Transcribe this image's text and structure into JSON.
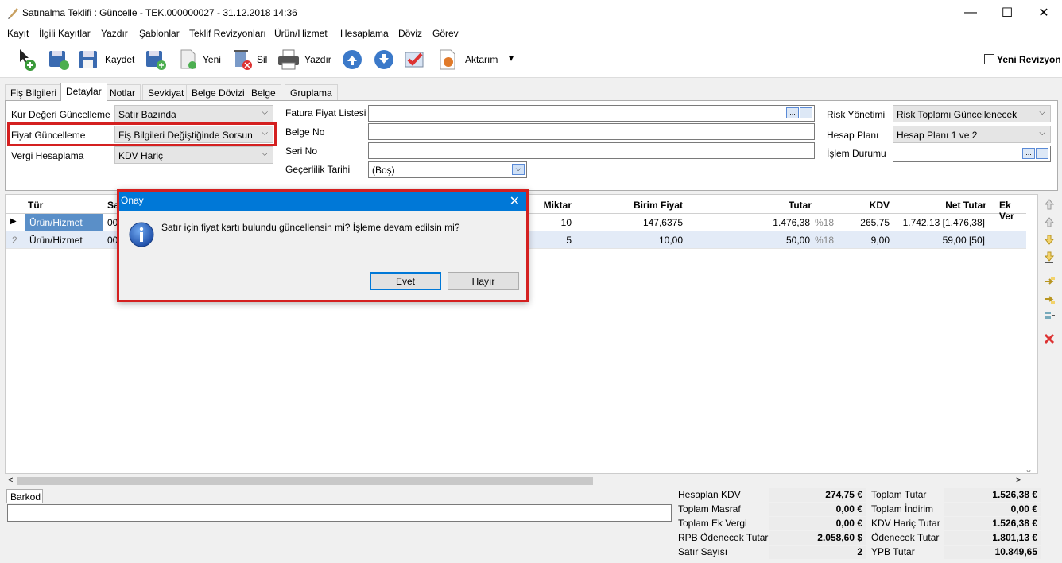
{
  "window": {
    "title": "Satınalma Teklifi : Güncelle - TEK.000000027 - 31.12.2018 14:36",
    "minimize": "—",
    "maximize": "☐",
    "close": "✕"
  },
  "menu": [
    "Kayıt",
    "İlgili Kayıtlar",
    "Yazdır",
    "Şablonlar",
    "Teklif Revizyonları",
    "Ürün/Hizmet",
    "Hesaplama",
    "Döviz",
    "Görev"
  ],
  "toolbar": {
    "save_label": "Kaydet",
    "new_label": "Yeni",
    "delete_label": "Sil",
    "print_label": "Yazdır",
    "export_label": "Aktarım",
    "export_arrow": "▾",
    "new_revision_label": "Yeni Revizyon"
  },
  "tabs": [
    "Fiş Bilgileri",
    "Detaylar",
    "Notlar",
    "Sevkiyat",
    "Belge Dövizi",
    "Belge",
    "Gruplama"
  ],
  "active_tab": "Detaylar",
  "details": {
    "kur_label": "Kur Değeri Güncelleme",
    "kur_value": "Satır Bazında",
    "fiyat_label": "Fiyat Güncelleme",
    "fiyat_value": "Fiş Bilgileri Değiştiğinde Sorsun",
    "vergi_label": "Vergi Hesaplama",
    "vergi_value": "KDV Hariç",
    "fatura_label": "Fatura Fiyat Listesi",
    "belge_no_label": "Belge No",
    "seri_no_label": "Seri No",
    "gecerlilik_label": "Geçerlilik Tarihi",
    "gecerlilik_value": "(Boş)",
    "risk_label": "Risk Yönetimi",
    "risk_value": "Risk Toplamı Güncellenecek",
    "hesap_label": "Hesap Planı",
    "hesap_value": "Hesap Planı 1 ve 2",
    "islem_label": "İşlem Durumu",
    "ellipsis": "...",
    "dropdown_arrow": "⌵"
  },
  "grid": {
    "headers": [
      "Tür",
      "Sa",
      "Miktar",
      "Birim Fiyat",
      "Tutar",
      "KDV",
      "Net Tutar",
      "Ek Ver"
    ],
    "rows": [
      {
        "indicator": "▶",
        "tur": "Ürün/Hizmet",
        "sa": "00",
        "miktar": "10",
        "birim": "147,6375",
        "tutar": "1.476,38",
        "kdvrate": "%18",
        "kdv": "265,75",
        "net": "1.742,13 [1.476,38]"
      },
      {
        "indicator": "2",
        "tur": "Ürün/Hizmet",
        "sa": "00",
        "miktar": "5",
        "birim": "10,00",
        "tutar": "50,00",
        "kdvrate": "%18",
        "kdv": "9,00",
        "net": "59,00 [50]"
      }
    ]
  },
  "barcode_tab": "Barkod",
  "totals": {
    "left": [
      {
        "label": "Hesaplan KDV",
        "value": "274,75 €"
      },
      {
        "label": "Toplam Masraf",
        "value": "0,00 €"
      },
      {
        "label": "Toplam Ek Vergi",
        "value": "0,00 €"
      },
      {
        "label": "RPB Ödenecek Tutar",
        "value": "2.058,60 $"
      },
      {
        "label": "Satır Sayısı",
        "value": "2"
      }
    ],
    "right": [
      {
        "label": "Toplam Tutar",
        "value": "1.526,38 €"
      },
      {
        "label": "Toplam İndirim",
        "value": "0,00 €"
      },
      {
        "label": "KDV Hariç Tutar",
        "value": "1.526,38 €"
      },
      {
        "label": "Ödenecek Tutar",
        "value": "1.801,13 €"
      },
      {
        "label": "YPB Tutar",
        "value": "10.849,65"
      }
    ]
  },
  "dialog": {
    "title": "Onay",
    "close": "✕",
    "message": "Satır için fiyat kartı bulundu güncellensin mi? İşleme devam edilsin mi?",
    "yes": "Evet",
    "no": "Hayır",
    "info_glyph": "i"
  },
  "scroll": {
    "left": "<",
    "right": ">",
    "down": "⌄"
  }
}
